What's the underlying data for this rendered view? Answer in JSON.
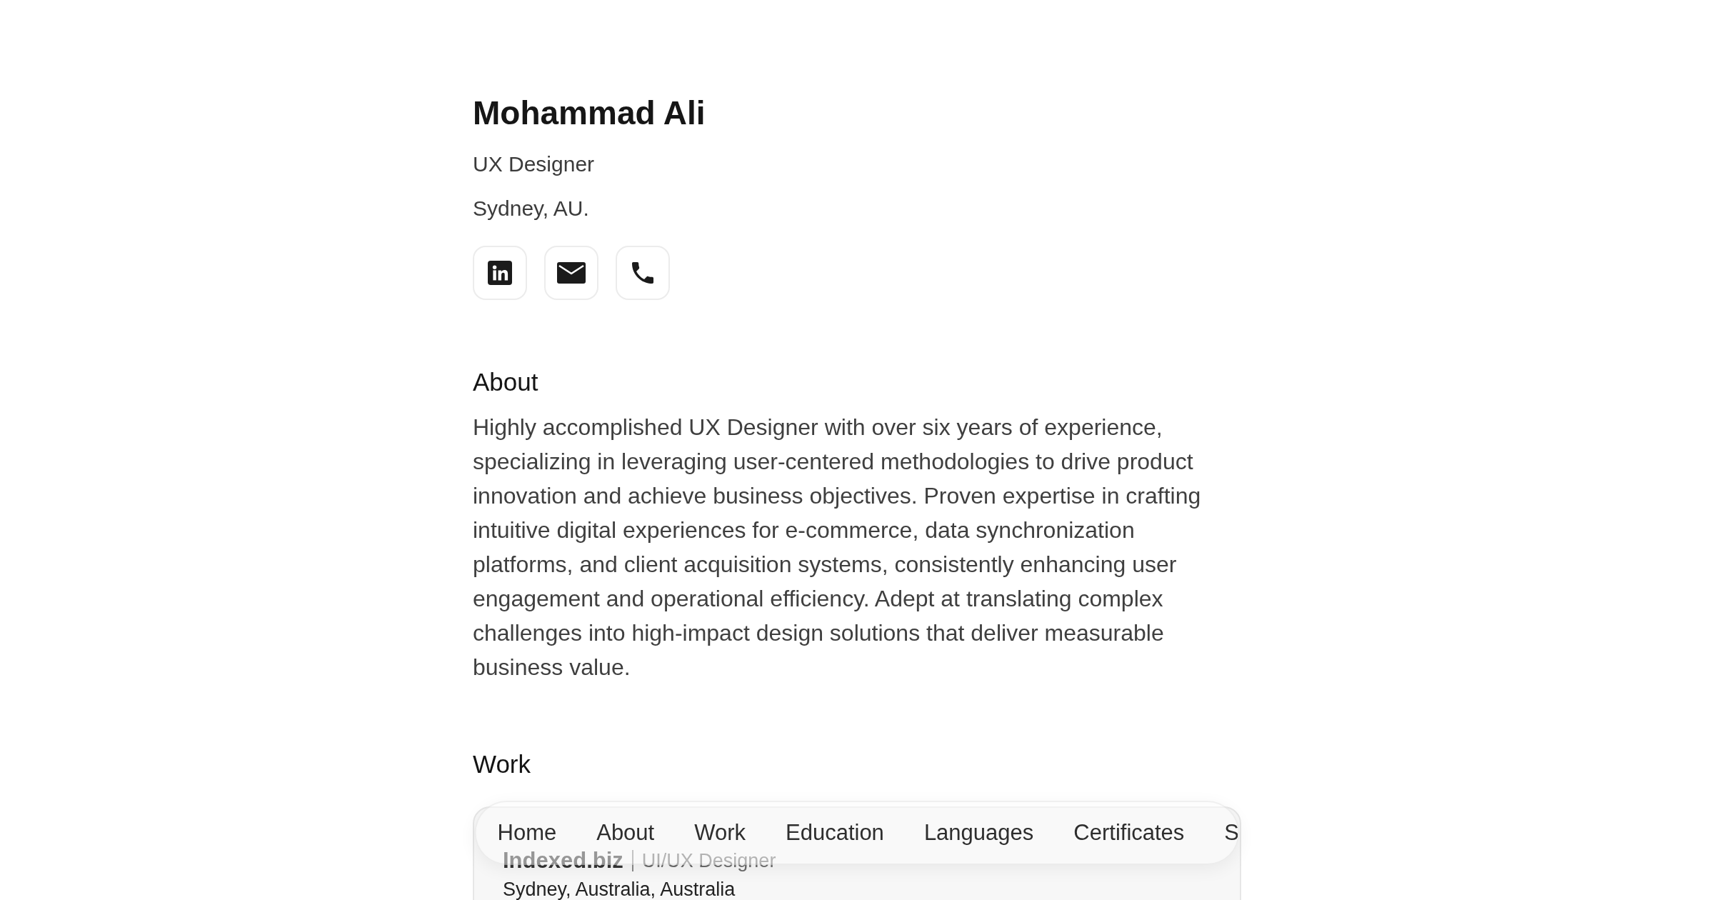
{
  "profile": {
    "name": "Mohammad Ali",
    "title": "UX Designer",
    "location": "Sydney, AU."
  },
  "contact_links": [
    {
      "kind": "linkedin"
    },
    {
      "kind": "email"
    },
    {
      "kind": "phone"
    }
  ],
  "about": {
    "heading": "About",
    "text": "Highly accomplished UX Designer with over six years of experience, specializing in leveraging user-centered methodologies to drive product innovation and achieve business objectives. Proven expertise in crafting intuitive digital experiences for e-commerce, data synchronization platforms, and client acquisition systems, consistently enhancing user engagement and operational efficiency. Adept at translating complex challenges into high-impact design solutions that deliver measurable business value."
  },
  "work": {
    "heading": "Work",
    "entries": [
      {
        "company": "Indexed.biz",
        "role": "UI/UX Designer",
        "location": "Sydney, Australia, Australia"
      }
    ]
  },
  "nav": {
    "items": [
      "Home",
      "About",
      "Work",
      "Education",
      "Languages",
      "Certificates",
      "S"
    ]
  }
}
